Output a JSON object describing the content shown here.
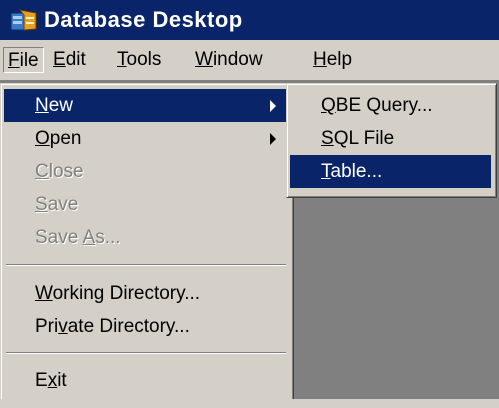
{
  "window": {
    "title": "Database Desktop",
    "icon": "database-desktop-icon"
  },
  "menubar": {
    "items": [
      {
        "label": "File",
        "mnemonic": "F",
        "rest": "ile",
        "open": true
      },
      {
        "label": "Edit",
        "mnemonic": "E",
        "rest": "dit"
      },
      {
        "label": "Tools",
        "mnemonic": "T",
        "rest": "ools"
      },
      {
        "label": "Window",
        "mnemonic": "W",
        "rest": "indow"
      },
      {
        "label": "Help",
        "mnemonic": "H",
        "rest": "elp"
      }
    ]
  },
  "file_menu": {
    "items": [
      {
        "label": "New",
        "pre": "",
        "mn": "N",
        "post": "ew",
        "state": "highlighted",
        "submenu": true
      },
      {
        "label": "Open",
        "pre": "",
        "mn": "O",
        "post": "pen",
        "state": "enabled",
        "submenu": true
      },
      {
        "label": "Close",
        "pre": "",
        "mn": "C",
        "post": "lose",
        "state": "disabled"
      },
      {
        "label": "Save",
        "pre": "",
        "mn": "S",
        "post": "ave",
        "state": "disabled"
      },
      {
        "label": "Save As...",
        "pre": "Save ",
        "mn": "A",
        "post": "s...",
        "state": "disabled"
      },
      {
        "label": "Working Directory...",
        "pre": "",
        "mn": "W",
        "post": "orking Directory...",
        "state": "enabled"
      },
      {
        "label": "Private Directory...",
        "pre": "Pri",
        "mn": "v",
        "post": "ate Directory...",
        "state": "enabled"
      },
      {
        "label": "Exit",
        "pre": "E",
        "mn": "x",
        "post": "it",
        "state": "enabled"
      }
    ]
  },
  "new_submenu": {
    "items": [
      {
        "label": "QBE Query...",
        "pre": "",
        "mn": "Q",
        "post": "BE Query...",
        "state": "enabled"
      },
      {
        "label": "SQL File",
        "pre": "",
        "mn": "S",
        "post": "QL File",
        "state": "enabled"
      },
      {
        "label": "Table...",
        "pre": "",
        "mn": "T",
        "post": "able...",
        "state": "highlighted"
      }
    ]
  },
  "colors": {
    "title_bar": "#0a246a",
    "menu_face": "#d4d0c8",
    "highlight": "#0a246a",
    "workspace": "#808080",
    "disabled_text": "#808080"
  }
}
